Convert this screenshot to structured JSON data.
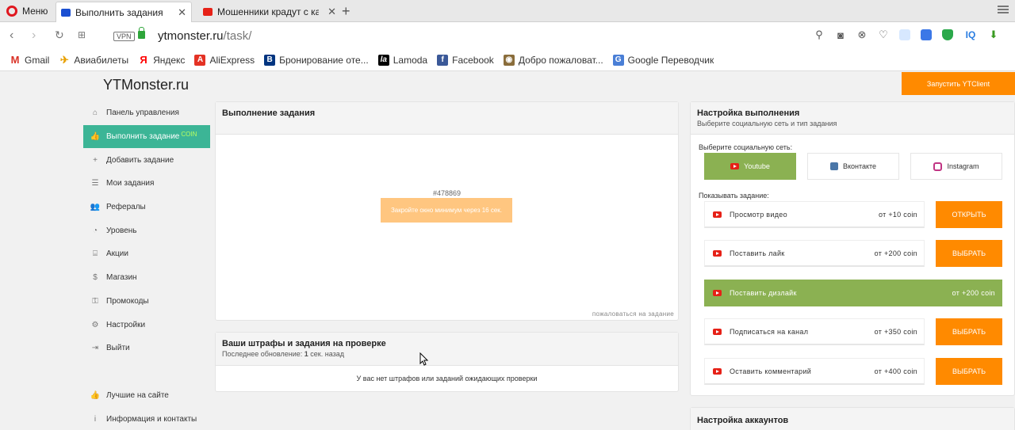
{
  "browser": {
    "menu_label": "Меню",
    "tabs": [
      {
        "title": "Выполнить задания",
        "favicon_color": "#1a4fd1"
      },
      {
        "title": "Мошенники крадут с карт",
        "favicon_color": "#e62117"
      }
    ],
    "address": {
      "vpn": "VPN",
      "host": "ytmonster.ru",
      "path": "/task/"
    },
    "bookmarks": [
      {
        "label": "Gmail",
        "color": "#d93025",
        "glyph": "M"
      },
      {
        "label": "Авиабилеты",
        "color": "#e8a000",
        "glyph": "✈"
      },
      {
        "label": "Яндекс",
        "color": "#ff0000",
        "glyph": "Я"
      },
      {
        "label": "AliExpress",
        "color": "#e43225",
        "glyph": "A"
      },
      {
        "label": "Бронирование оте...",
        "color": "#003580",
        "glyph": "B"
      },
      {
        "label": "Lamoda",
        "color": "#000000",
        "glyph": "la"
      },
      {
        "label": "Facebook",
        "color": "#3b5998",
        "glyph": "f"
      },
      {
        "label": "Добро пожаловат...",
        "color": "#8a6d3b",
        "glyph": "◉"
      },
      {
        "label": "Google Переводчик",
        "color": "#4a7fd6",
        "glyph": "G"
      }
    ]
  },
  "site": {
    "logo": "YTMonster.ru",
    "launch_button": "Запустить YTClient"
  },
  "sidebar": {
    "items": [
      {
        "label": "Панель управления",
        "icon": "home-icon",
        "glyph": "⌂"
      },
      {
        "label": "Выполнить задание",
        "icon": "thumbs-up-icon",
        "glyph": "👍",
        "badge": "COIN",
        "active": true
      },
      {
        "label": "Добавить задание",
        "icon": "plus-icon",
        "glyph": "+"
      },
      {
        "label": "Мои задания",
        "icon": "list-icon",
        "glyph": "☰"
      },
      {
        "label": "Рефералы",
        "icon": "users-icon",
        "glyph": "👥"
      },
      {
        "label": "Уровень",
        "icon": "gauge-icon",
        "glyph": "◔"
      },
      {
        "label": "Акции",
        "icon": "gift-icon",
        "glyph": "⌸"
      },
      {
        "label": "Магазин",
        "icon": "dollar-icon",
        "glyph": "$"
      },
      {
        "label": "Промокоды",
        "icon": "key-icon",
        "glyph": "⚿"
      },
      {
        "label": "Настройки",
        "icon": "gear-icon",
        "glyph": "⚙"
      },
      {
        "label": "Выйти",
        "icon": "logout-icon",
        "glyph": "⇥"
      }
    ],
    "bottom": [
      {
        "label": "Лучшие на сайте",
        "icon": "thumbs-up-icon",
        "glyph": "👍"
      },
      {
        "label": "Информация и контакты",
        "icon": "info-icon",
        "glyph": "i"
      }
    ]
  },
  "task_panel": {
    "title": "Выполнение задания",
    "task_id": "#478869",
    "button": "Закройте окно минимум через 16 сек.",
    "complain": "пожаловаться на задание"
  },
  "penalty_panel": {
    "title": "Ваши штрафы и задания на проверке",
    "updated_prefix": "Последнее обновление:",
    "updated_value": "1",
    "updated_suffix": "сек. назад",
    "empty": "У вас нет штрафов или заданий ожидающих проверки"
  },
  "settings_panel": {
    "title": "Настройка выполнения",
    "subtitle": "Выберите социальную сеть и тип задания",
    "network_label": "Выберите социальную сеть:",
    "networks": [
      {
        "label": "Youtube",
        "active": true
      },
      {
        "label": "Вконтакте",
        "active": false
      },
      {
        "label": "Instagram",
        "active": false
      }
    ],
    "show_label": "Показывать задание:",
    "tasks": [
      {
        "name": "Просмотр видео",
        "reward": "от +10 coin",
        "action": "ОТКРЫТЬ"
      },
      {
        "name": "Поставить лайк",
        "reward": "от +200 coin",
        "action": "ВЫБРАТЬ"
      },
      {
        "name": "Поставить дизлайк",
        "reward": "от +200 coin",
        "action": ""
      },
      {
        "name": "Подписаться на канал",
        "reward": "от +350 coin",
        "action": "ВЫБРАТЬ"
      },
      {
        "name": "Оставить комментарий",
        "reward": "от +400 coin",
        "action": "ВЫБРАТЬ"
      }
    ]
  },
  "accounts_panel": {
    "title": "Настройка аккаунтов"
  },
  "colors": {
    "accent_green": "#3cb596",
    "select_green": "#8bb152",
    "orange": "#ff8a00"
  }
}
